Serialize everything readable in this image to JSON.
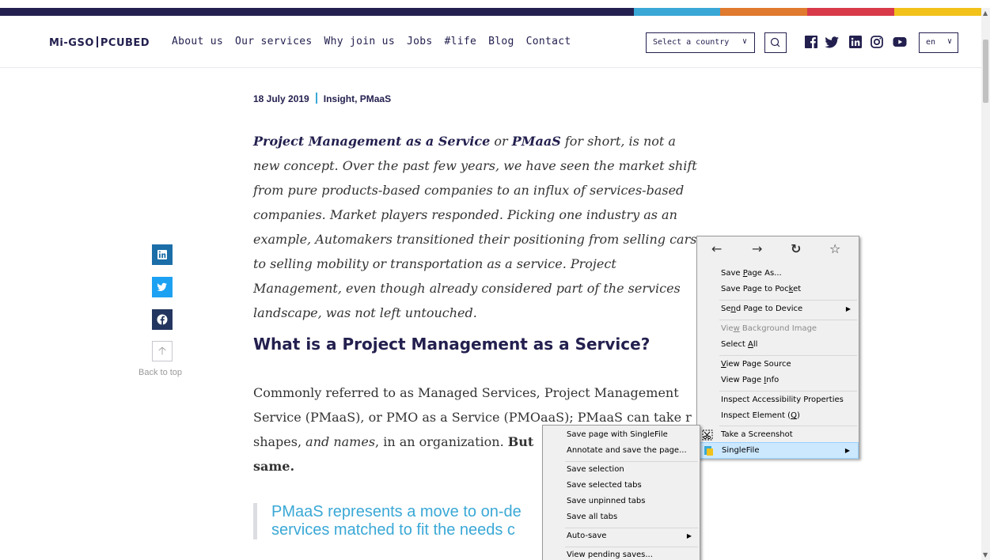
{
  "colors": {
    "navy": "#23204f",
    "blue": "#3aa8d6",
    "orange": "#e07a2e",
    "red": "#d83a4a",
    "yellow": "#f2c21a"
  },
  "header": {
    "logo_left": "Mi-GSO",
    "logo_right": "PCUBED",
    "nav": [
      "About us",
      "Our services",
      "Why join us",
      "Jobs",
      "#life",
      "Blog",
      "Contact"
    ],
    "country_select": "Select a country",
    "search_icon": "search-icon",
    "social_icons": [
      "facebook-icon",
      "twitter-icon",
      "linkedin-icon",
      "instagram-icon",
      "youtube-icon"
    ],
    "language": "en"
  },
  "article": {
    "date": "18 July 2019",
    "tags": "Insight, PMaaS",
    "lead": {
      "b1": "Project Management as a Service",
      "t1": " or ",
      "b2": "PMaaS",
      "t2": " for short, is not a new concept. Over the past few years, we have seen the market shift from pure products-based companies to an influx of services-based companies. Market players responded. Picking one industry as an example, Automakers transitioned their positioning from selling cars to selling mobility or transportation as a service. Project Management, even though already considered part of the services landscape, was not left untouched."
    },
    "heading": "What is a Project Management as a Service?",
    "para_line1": "Commonly referred to as Managed Services, Project Management",
    "para_line2": "Service (PMaaS), or PMO as a Service (PMOaaS); PMaaS can take r",
    "para_line3_a": "shapes, ",
    "para_line3_b": "and names",
    "para_line3_c": ", in an organization. ",
    "para_line3_d": "But",
    "para_line4": "same.",
    "quote_line1": "PMaaS represents a move to on-de",
    "quote_line2": "services matched to fit the needs c"
  },
  "share": {
    "icons": [
      "linkedin-icon",
      "twitter-icon",
      "facebook-icon"
    ],
    "back_to_top": "Back to top"
  },
  "context_menu": {
    "nav_icons": [
      "back-arrow-icon",
      "forward-arrow-icon",
      "reload-icon",
      "bookmark-star-icon"
    ],
    "items": [
      {
        "pre": "Save ",
        "u": "P",
        "post": "age As...",
        "disabled": false
      },
      {
        "pre": "Save Page to Poc",
        "u": "k",
        "post": "et",
        "disabled": false
      },
      {
        "pre": "Se",
        "u": "n",
        "post": "d Page to Device",
        "disabled": false,
        "submenu": true
      },
      {
        "pre": "Vie",
        "u": "w",
        "post": " Background Image",
        "disabled": true
      },
      {
        "pre": "Select ",
        "u": "A",
        "post": "ll",
        "disabled": false
      },
      {
        "pre": "",
        "u": "V",
        "post": "iew Page Source",
        "disabled": false
      },
      {
        "pre": "View Page ",
        "u": "I",
        "post": "nfo",
        "disabled": false
      },
      {
        "pre": "Inspect Accessibility Properties",
        "u": "",
        "post": "",
        "disabled": false
      },
      {
        "pre": "Inspect Element (",
        "u": "Q",
        "post": ")",
        "disabled": false
      },
      {
        "pre": "Take a Screenshot",
        "u": "",
        "post": "",
        "disabled": false
      },
      {
        "pre": "SingleFile",
        "u": "",
        "post": "",
        "disabled": false,
        "submenu": true,
        "highlighted": true
      }
    ]
  },
  "submenu": {
    "items": [
      {
        "label": "Save page with SingleFile"
      },
      {
        "label": "Annotate and save the page..."
      },
      {
        "label": "Save selection"
      },
      {
        "label": "Save selected tabs"
      },
      {
        "label": "Save unpinned tabs"
      },
      {
        "label": "Save all tabs"
      },
      {
        "label": "Auto-save",
        "submenu": true
      },
      {
        "label": "View pending saves..."
      }
    ]
  }
}
